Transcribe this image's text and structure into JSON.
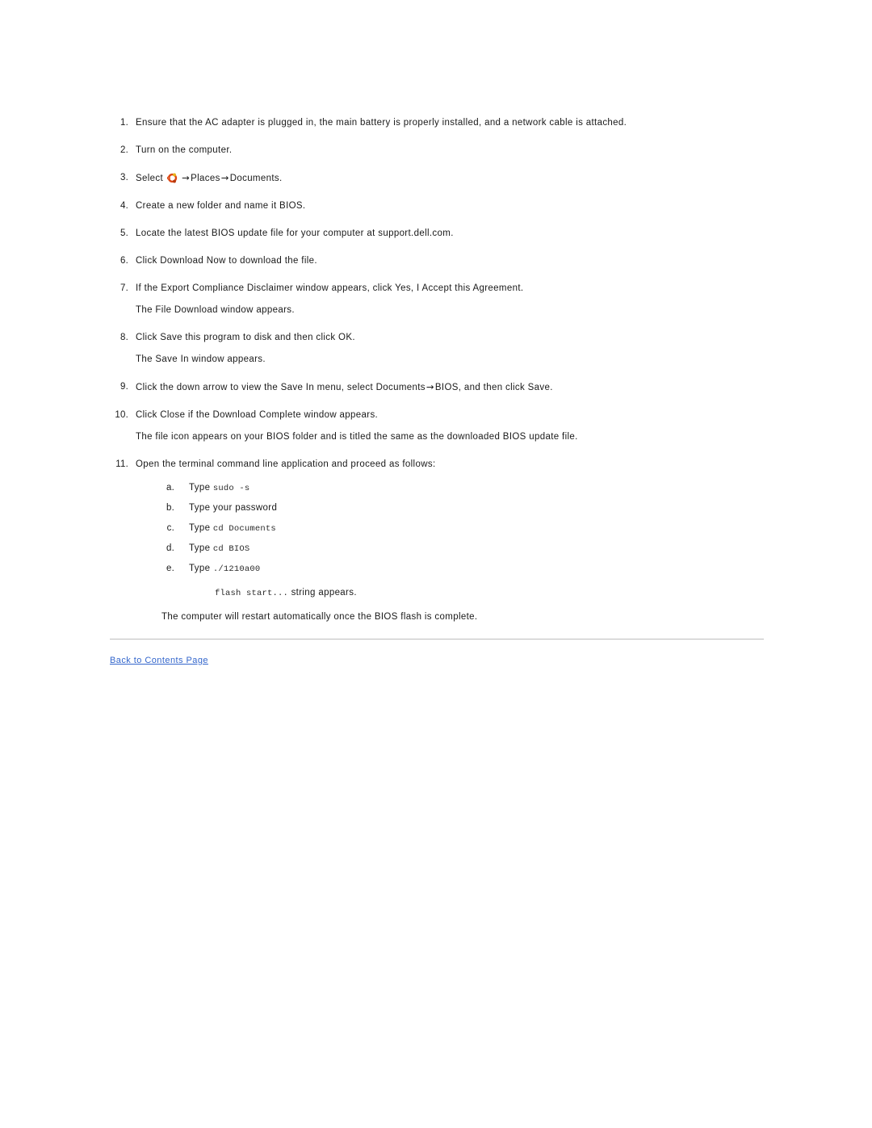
{
  "document": {
    "type": "instruction-list",
    "footer_link_color": "#3366cc",
    "text_color": "#1a1a1a",
    "rule_color": "#bdbdbd"
  },
  "steps": [
    {
      "num": "1.",
      "text": "Ensure that the AC adapter is plugged in, the main battery is properly installed, and a network cable is attached."
    },
    {
      "num": "2.",
      "text": "Turn on the computer."
    },
    {
      "num": "3.",
      "prefix": "Select",
      "icon": "ubuntu-logo-icon",
      "arrow1": "→",
      "mid": "Places",
      "arrow2": "→",
      "suffix": "Documents."
    },
    {
      "num": "4.",
      "text": "Create a new folder and name it BIOS."
    },
    {
      "num": "5.",
      "text": "Locate the latest BIOS update file for your computer at support.dell.com."
    },
    {
      "num": "6.",
      "text": "Click Download Now to download the file."
    },
    {
      "num": "7.",
      "text": "If the Export Compliance Disclaimer window appears, click Yes, I Accept this Agreement.",
      "follow": "The File Download window appears."
    },
    {
      "num": "8.",
      "text": "Click Save this program to disk and then click OK.",
      "follow": "The Save In window appears."
    },
    {
      "num": "9.",
      "prefix": "Click the down arrow to view the Save In menu, select Documents",
      "arrow1": "→",
      "suffix": "BIOS, and then click Save."
    },
    {
      "num": "10.",
      "text": "Click Close if the Download Complete window appears.",
      "follow": "The file icon appears on your BIOS folder and is titled the same as the downloaded BIOS update file."
    },
    {
      "num": "11.",
      "text": "Open the terminal command line application and proceed as follows:"
    }
  ],
  "substeps": [
    {
      "num": "a.",
      "label": "Type",
      "command": "sudo -s"
    },
    {
      "num": "b.",
      "label": "Type your password",
      "command": ""
    },
    {
      "num": "c.",
      "label": "Type",
      "command": "cd Documents"
    },
    {
      "num": "d.",
      "label": "Type",
      "command": "cd BIOS"
    },
    {
      "num": "e.",
      "label": "Type",
      "command": "./1210a00"
    }
  ],
  "notes": {
    "flash_command": "flash start...",
    "flash_suffix": "string appears.",
    "closing": "The computer will restart automatically once the BIOS flash is complete."
  },
  "footer": {
    "back_link": "Back to Contents Page"
  }
}
